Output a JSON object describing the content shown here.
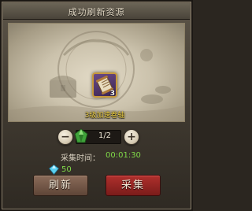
{
  "dialog": {
    "title": "成功刷新资源"
  },
  "item": {
    "icon": "scroll-icon",
    "count": "3",
    "name": "3级加速卷轴",
    "name_color": "#f2d244"
  },
  "stepper": {
    "value": "1/2",
    "minus_label": "−",
    "plus_label": "+",
    "icon": "green-gem-icon"
  },
  "collect_time": {
    "label": "采集时间：",
    "value": "00:01:30",
    "value_color": "#7fd848"
  },
  "cost": {
    "icon": "diamond-icon",
    "value": "50"
  },
  "buttons": {
    "refresh_label": "刷新",
    "collect_label": "采集"
  }
}
